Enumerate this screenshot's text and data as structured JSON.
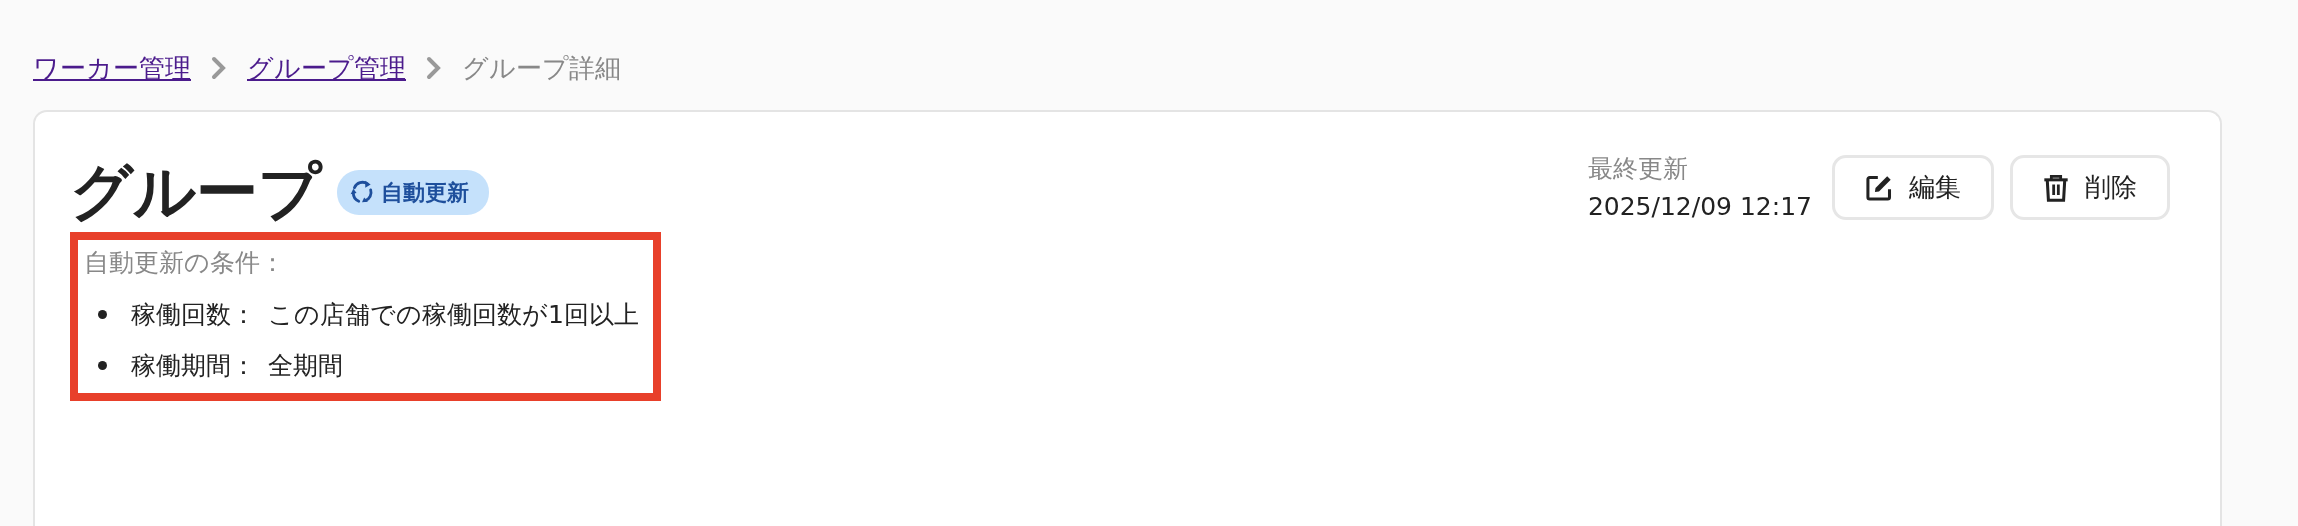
{
  "breadcrumb": [
    {
      "label": "ワーカー管理",
      "kind": "link"
    },
    {
      "label": "グループ管理",
      "kind": "link"
    },
    {
      "label": "グループ詳細",
      "kind": "current"
    }
  ],
  "title": "グループ",
  "badge": "自動更新",
  "last_updated": {
    "label": "最終更新",
    "value": "2025/12/09 12:17"
  },
  "buttons": [
    {
      "label": "編集",
      "kind": "edit"
    },
    {
      "label": "削除",
      "kind": "delete"
    }
  ],
  "conditions": {
    "heading": "自動更新の条件：",
    "highlighted": true,
    "items": [
      {
        "label": "稼働回数：",
        "value": "この店舗での稼働回数が1回以上"
      },
      {
        "label": "稼働期間：",
        "value": "全期間"
      }
    ]
  }
}
